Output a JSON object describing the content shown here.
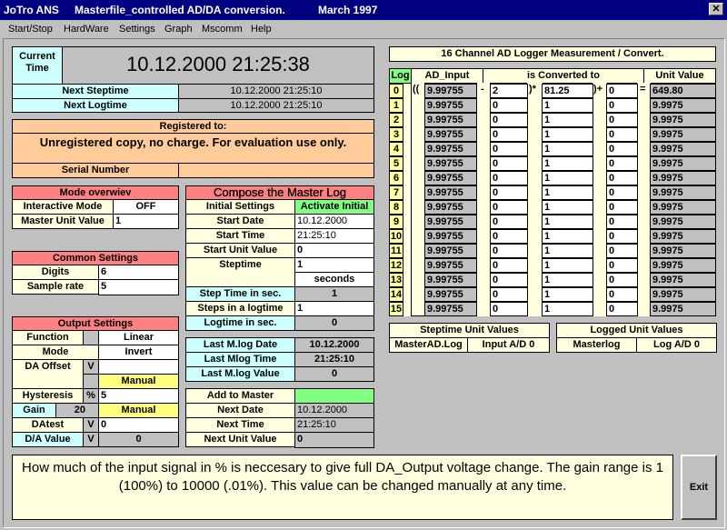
{
  "titlebar": {
    "app": "JoTro ANS",
    "subtitle": "Masterfile_controlled AD/DA conversion.",
    "date": "March  1997",
    "close_label": "✕"
  },
  "menu": {
    "items": [
      {
        "label": "Start/Stop"
      },
      {
        "label": "HardWare"
      },
      {
        "label": "Settings"
      },
      {
        "label": "Graph"
      },
      {
        "label": "Mscomm"
      },
      {
        "label": "Help"
      }
    ]
  },
  "time_panel": {
    "current_label_1": "Current",
    "current_label_2": "Time",
    "current_value": "10.12.2000 21:25:38",
    "next_steptime_label": "Next Steptime",
    "next_steptime_value": "10.12.2000 21:25:10",
    "next_logtime_label": "Next Logtime",
    "next_logtime_value": "10.12.2000 21:25:10"
  },
  "registration": {
    "header": "Registered to:",
    "text": "Unregistered copy, no charge. For evaluation use only.",
    "serial_label": "Serial Number",
    "serial_value": ""
  },
  "mode": {
    "header": "Mode overwiev",
    "interactive_label": "Interactive Mode",
    "interactive_value": "OFF",
    "master_label": "Master Unit Value",
    "master_value": "1"
  },
  "common": {
    "header": "Common Settings",
    "digits_label": "Digits",
    "digits_value": "6",
    "sample_label": "Sample rate",
    "sample_value": "5"
  },
  "output": {
    "header": "Output Settings",
    "function_label": "Function",
    "function_value": "Linear",
    "mode_label": "Mode",
    "mode_value": "Invert",
    "offset_label": "DA Offset",
    "offset_unit": "V",
    "offset_value": "",
    "offset_manual": "Manual",
    "hyst_label": "Hysteresis",
    "hyst_unit": "%",
    "hyst_value": "5",
    "gain_label": "Gain",
    "gain_value": "20",
    "gain_manual": "Manual",
    "datest_label": "DAtest",
    "datest_unit": "V",
    "datest_value": "0",
    "davalue_label": "D/A Value",
    "davalue_unit": "V",
    "davalue_value": "0"
  },
  "compose": {
    "header": "Compose the Master Log",
    "initial_label": "Initial Settings",
    "initial_button": "Activate Initial",
    "start_date_label": "Start Date",
    "start_date_value": "10.12.2000",
    "start_time_label": "Start Time",
    "start_time_value": "21:25:10",
    "start_unit_label": "Start Unit Value",
    "start_unit_value": "0",
    "steptime_label": "Steptime",
    "steptime_value": "1",
    "steptime_unit": "seconds",
    "step_sec_label": "Step Time in sec.",
    "step_sec_value": "1",
    "steps_log_label": "Steps in a logtime",
    "steps_log_value": "1",
    "logtime_label": "Logtime in sec.",
    "logtime_value": "0"
  },
  "last_log": {
    "date_label": "Last M.log Date",
    "date_value": "10.12.2000",
    "time_label": "Last Mlog Time",
    "time_value": "21:25:10",
    "value_label": "Last M.log Value",
    "value_value": "0"
  },
  "add_master": {
    "label": "Add to Master",
    "next_date_label": "Next Date",
    "next_date_value": "10.12.2000",
    "next_time_label": "Next Time",
    "next_time_value": "21:25:10",
    "next_unit_label": "Next Unit Value",
    "next_unit_value": "0"
  },
  "logger": {
    "title": "16 Channel AD Logger Measurement / Convert.",
    "col_log": "Log",
    "col_input": "AD_Input",
    "col_convert": "is Converted to",
    "col_unit": "Unit Value",
    "op_open": "((",
    "op_minus": "-",
    "op_mul": ")*",
    "op_plus": ")+",
    "op_eq": "=",
    "rows": [
      {
        "ch": "0",
        "input": "9.99755",
        "sub": "2",
        "mul": "81.25",
        "add": "0",
        "unit": "649.80"
      },
      {
        "ch": "1",
        "input": "9.99755",
        "sub": "0",
        "mul": "1",
        "add": "0",
        "unit": "9.9975"
      },
      {
        "ch": "2",
        "input": "9.99755",
        "sub": "0",
        "mul": "1",
        "add": "0",
        "unit": "9.9975"
      },
      {
        "ch": "3",
        "input": "9.99755",
        "sub": "0",
        "mul": "1",
        "add": "0",
        "unit": "9.9975"
      },
      {
        "ch": "4",
        "input": "9.99755",
        "sub": "0",
        "mul": "1",
        "add": "0",
        "unit": "9.9975"
      },
      {
        "ch": "5",
        "input": "9.99755",
        "sub": "0",
        "mul": "1",
        "add": "0",
        "unit": "9.9975"
      },
      {
        "ch": "6",
        "input": "9.99755",
        "sub": "0",
        "mul": "1",
        "add": "0",
        "unit": "9.9975"
      },
      {
        "ch": "7",
        "input": "9.99755",
        "sub": "0",
        "mul": "1",
        "add": "0",
        "unit": "9.9975"
      },
      {
        "ch": "8",
        "input": "9.99755",
        "sub": "0",
        "mul": "1",
        "add": "0",
        "unit": "9.9975"
      },
      {
        "ch": "9",
        "input": "9.99755",
        "sub": "0",
        "mul": "1",
        "add": "0",
        "unit": "9.9975"
      },
      {
        "ch": "10",
        "input": "9.99755",
        "sub": "0",
        "mul": "1",
        "add": "0",
        "unit": "9.9975"
      },
      {
        "ch": "11",
        "input": "9.99755",
        "sub": "0",
        "mul": "1",
        "add": "0",
        "unit": "9.9975"
      },
      {
        "ch": "12",
        "input": "9.99755",
        "sub": "0",
        "mul": "1",
        "add": "0",
        "unit": "9.9975"
      },
      {
        "ch": "13",
        "input": "9.99755",
        "sub": "0",
        "mul": "1",
        "add": "0",
        "unit": "9.9975"
      },
      {
        "ch": "14",
        "input": "9.99755",
        "sub": "0",
        "mul": "1",
        "add": "0",
        "unit": "9.9975"
      },
      {
        "ch": "15",
        "input": "9.99755",
        "sub": "0",
        "mul": "1",
        "add": "0",
        "unit": "9.9975"
      }
    ]
  },
  "steptime_units": {
    "header": "Steptime Unit Values",
    "file": "MasterAD.Log",
    "input": "Input A/D 0"
  },
  "logged_units": {
    "header": "Logged Unit Values",
    "file": "Masterlog",
    "log": "Log A/D 0"
  },
  "info": {
    "text": "How much of the input signal in % is neccesary to give full DA_Output voltage change. The gain range is 1 (100%) to 10000 (.01%). This value can be changed manually at any time."
  },
  "exit_label": "Exit"
}
